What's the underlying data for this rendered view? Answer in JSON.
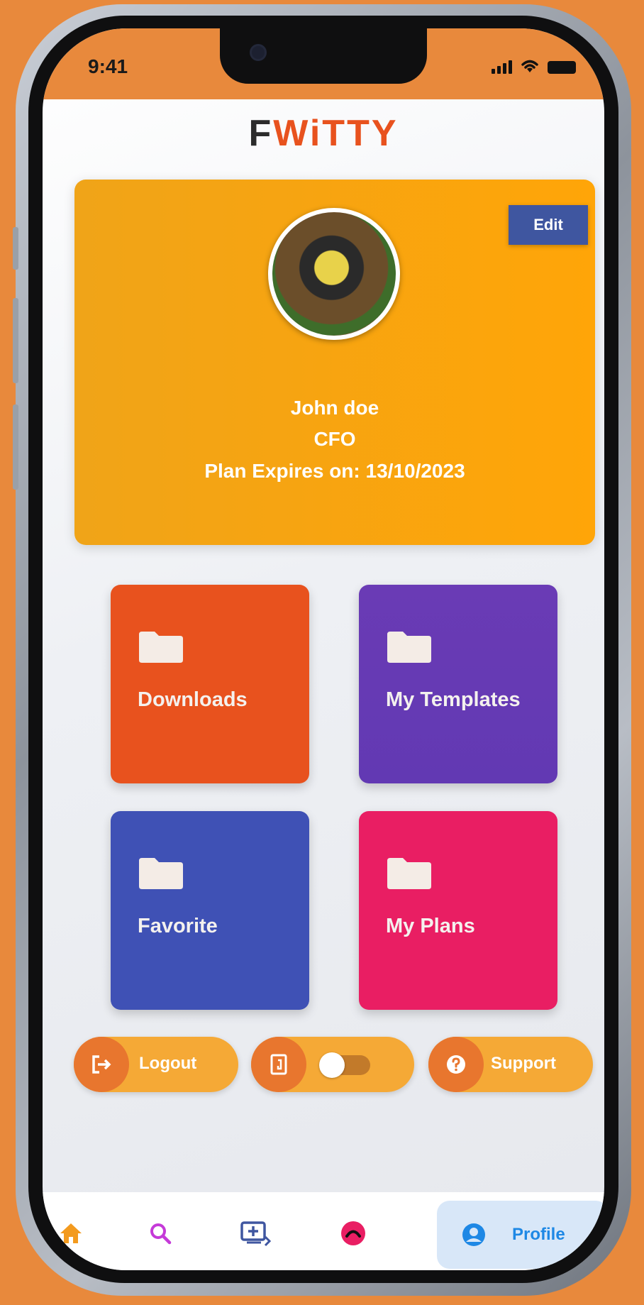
{
  "status_bar": {
    "time": "9:41"
  },
  "app": {
    "logo_f": "F",
    "logo_rest": "WiTTY"
  },
  "profile": {
    "name": "John doe",
    "role": "CFO",
    "plan_expiry": "Plan Expires on: 13/10/2023",
    "edit_label": "Edit"
  },
  "tiles": [
    {
      "label": "Downloads",
      "color": "#E8521E"
    },
    {
      "label": "My Templates",
      "color": "#673AB7"
    },
    {
      "label": "Favorite",
      "color": "#3F51B5"
    },
    {
      "label": "My Plans",
      "color": "#E91E63"
    }
  ],
  "actions": {
    "logout_label": "Logout",
    "support_label": "Support",
    "toggle_state": "off"
  },
  "bottom_nav": {
    "items": [
      "home-icon",
      "search-icon",
      "templates-icon",
      "plans-icon",
      "profile-icon"
    ],
    "active_label": "Profile"
  },
  "colors": {
    "background": "#E8893C",
    "card": "#FFA508",
    "edit_button": "#3F56A0",
    "pill": "#F5A936",
    "nav_active": "#1E88E5"
  }
}
